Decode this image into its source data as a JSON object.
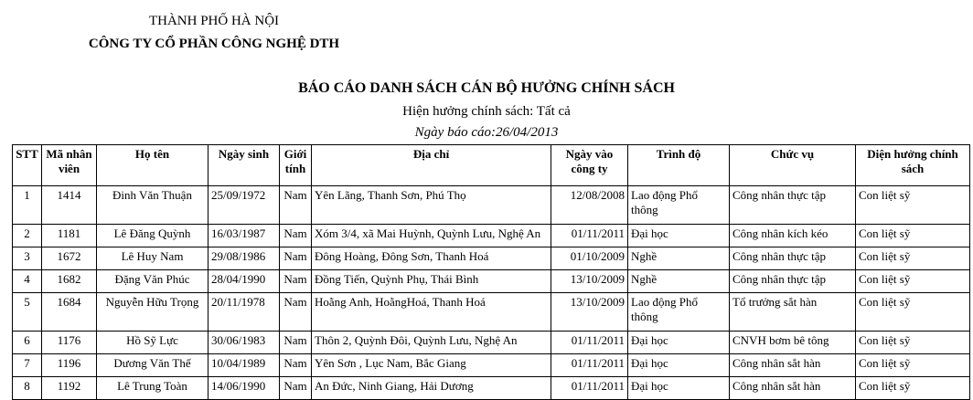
{
  "header": {
    "city": "THÀNH PHỐ HÀ NỘI",
    "company": "CÔNG TY CỔ PHẦN CÔNG NGHỆ DTH"
  },
  "report": {
    "title": "BÁO CÁO DANH SÁCH CÁN BỘ HƯỞNG CHÍNH SÁCH",
    "subtitle": "Hiện hưởng chính sách: Tất cả",
    "date_line": "Ngày báo cáo:26/04/2013"
  },
  "table": {
    "columns": [
      "STT",
      "Mã nhân viên",
      "Họ tên",
      "Ngày sinh",
      "Giới tính",
      "Địa chỉ",
      "Ngày vào công ty",
      "Trình độ",
      "Chức vụ",
      "Diện hưởng chính sách"
    ],
    "rows": [
      {
        "stt": "1",
        "ma": "1414",
        "ten": "Đinh Văn Thuận",
        "ngay_sinh": "25/09/1972",
        "gioi_tinh": "Nam",
        "dia_chi": "Yên Lãng, Thanh Sơn, Phú Thọ",
        "ngay_vao": "12/08/2008",
        "trinh_do": "Lao động Phổ thông",
        "chuc_vu": "Công nhân thực tập",
        "dien": "Con liệt sỹ"
      },
      {
        "stt": "2",
        "ma": "1181",
        "ten": "Lê Đăng Quỳnh",
        "ngay_sinh": "16/03/1987",
        "gioi_tinh": "Nam",
        "dia_chi": "Xóm 3/4, xã Mai Huỳnh, Quỳnh Lưu, Nghệ An",
        "ngay_vao": "01/11/2011",
        "trinh_do": "Đại học",
        "chuc_vu": "Công nhân kích kéo",
        "dien": "Con liệt sỹ"
      },
      {
        "stt": "3",
        "ma": "1672",
        "ten": "Lê Huy Nam",
        "ngay_sinh": "29/08/1986",
        "gioi_tinh": "Nam",
        "dia_chi": "Đông Hoàng, Đông Sơn, Thanh Hoá",
        "ngay_vao": "01/10/2009",
        "trinh_do": "Nghề",
        "chuc_vu": "Công nhân thực tập",
        "dien": "Con liệt sỹ"
      },
      {
        "stt": "4",
        "ma": "1682",
        "ten": "Đặng Văn Phúc",
        "ngay_sinh": "28/04/1990",
        "gioi_tinh": "Nam",
        "dia_chi": "Đồng Tiến, Quỳnh Phụ, Thái Bình",
        "ngay_vao": "13/10/2009",
        "trinh_do": "Nghề",
        "chuc_vu": "Công nhân thực tập",
        "dien": "Con liệt sỹ"
      },
      {
        "stt": "5",
        "ma": "1684",
        "ten": "Nguyễn Hữu Trọng",
        "ngay_sinh": "20/11/1978",
        "gioi_tinh": "Nam",
        "dia_chi": "Hoằng Anh, HoằngHoá, Thanh Hoá",
        "ngay_vao": "13/10/2009",
        "trinh_do": "Lao động Phổ thông",
        "chuc_vu": "Tổ trưởng sắt hàn",
        "dien": "Con liệt sỹ"
      },
      {
        "stt": "6",
        "ma": "1176",
        "ten": "Hồ Sỹ Lực",
        "ngay_sinh": "30/06/1983",
        "gioi_tinh": "Nam",
        "dia_chi": "Thôn 2, Quỳnh Đôi, Quỳnh Lưu, Nghệ An",
        "ngay_vao": "01/11/2011",
        "trinh_do": "Đại học",
        "chuc_vu": "CNVH bơm bê tông",
        "dien": "Con liệt sỹ"
      },
      {
        "stt": "7",
        "ma": "1196",
        "ten": "Dương Văn Thế",
        "ngay_sinh": "10/04/1989",
        "gioi_tinh": "Nam",
        "dia_chi": "Yên Sơn , Lục Nam, Bắc Giang",
        "ngay_vao": "01/11/2011",
        "trinh_do": "Đại học",
        "chuc_vu": "Công nhân sắt hàn",
        "dien": "Con liệt sỹ"
      },
      {
        "stt": "8",
        "ma": "1192",
        "ten": "Lê Trung Toàn",
        "ngay_sinh": "14/06/1990",
        "gioi_tinh": "Nam",
        "dia_chi": "An Đức, Ninh Giang, Hải Dương",
        "ngay_vao": "01/11/2011",
        "trinh_do": "Đại học",
        "chuc_vu": "Công nhân sắt hàn",
        "dien": "Con liệt sỹ"
      }
    ]
  }
}
